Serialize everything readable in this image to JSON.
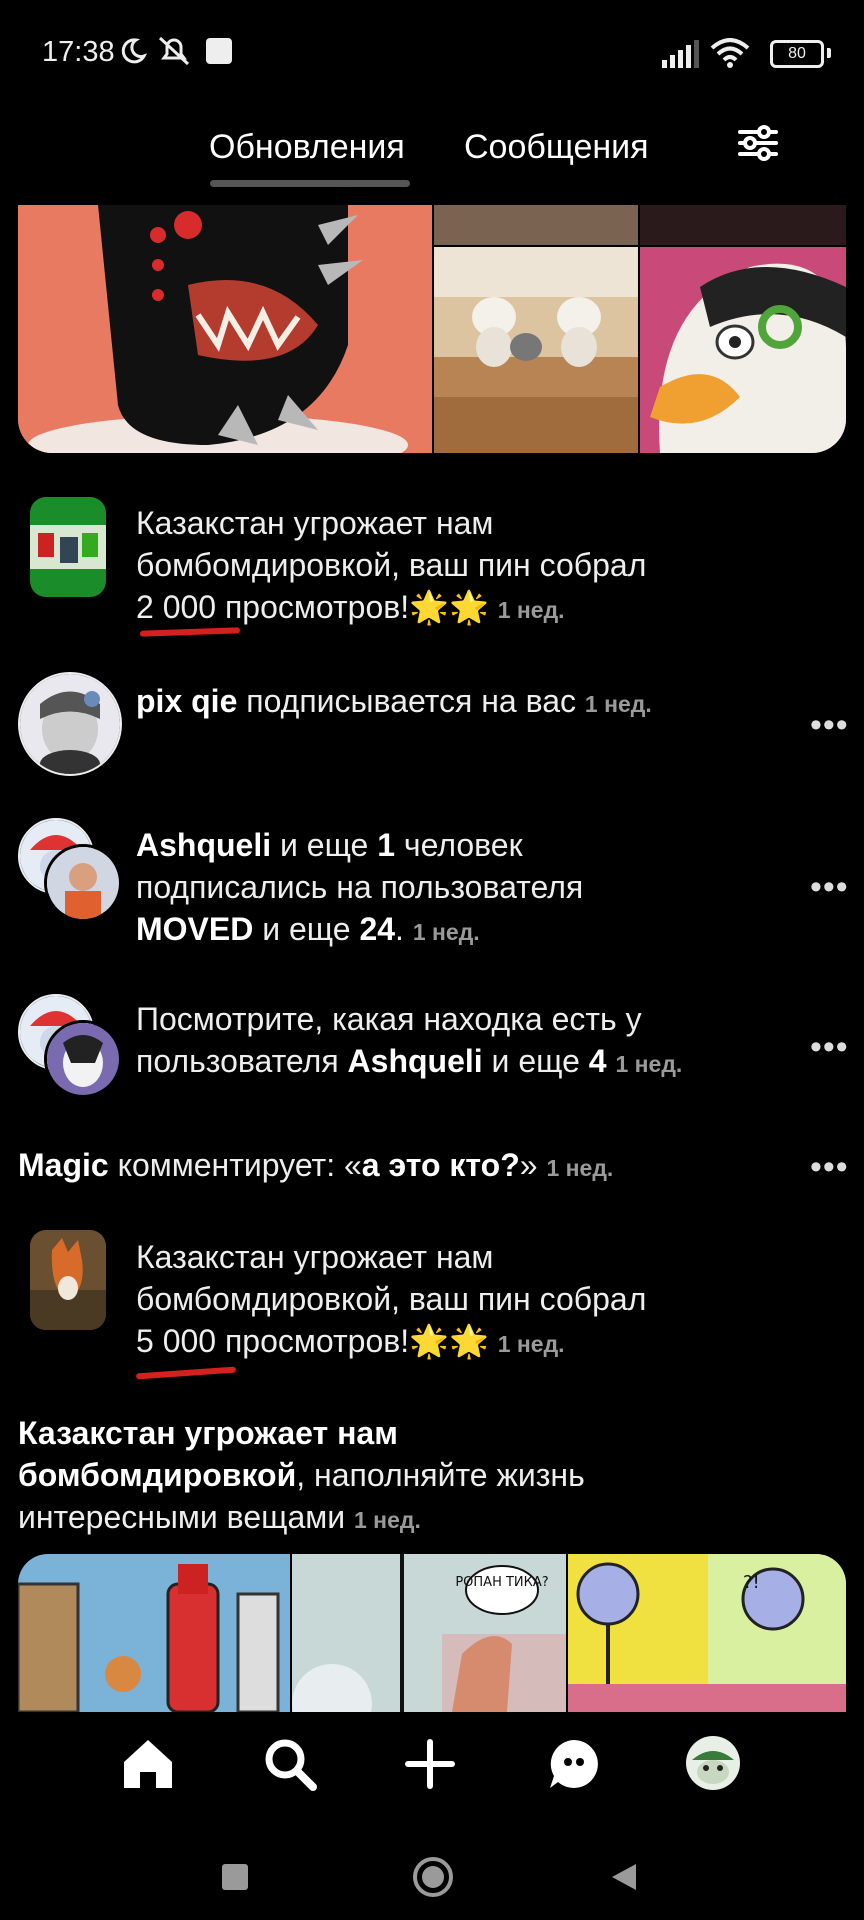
{
  "status_bar": {
    "time": "17:38",
    "battery": "80"
  },
  "tabs": {
    "updates": "Обновления",
    "messages": "Сообщения"
  },
  "notifications": [
    {
      "title_l1": "Казакстан угрожает нам",
      "title_l2": "бомбомдировкой, ваш пин собрал",
      "views": "2 000",
      "views_suffix": "просмотров!",
      "stars": "🌟🌟",
      "time": "1 нед."
    },
    {
      "user": "pix qie",
      "text": "подписывается на вас",
      "time": "1 нед."
    },
    {
      "user": "Ashqueli",
      "mid": "и еще",
      "count": "1",
      "mid2": "человек",
      "line2": "подписались на пользователя",
      "target": "MOVED",
      "mid3": "и еще",
      "count2": "24",
      "dot": ".",
      "time": "1 нед."
    },
    {
      "line1": "Посмотрите, какая находка есть у",
      "line2_pre": "пользователя",
      "user": "Ashqueli",
      "mid": "и еще",
      "count": "4",
      "time": "1 нед."
    },
    {
      "user": "Magic",
      "text": "комментирует: «",
      "quote": "а это кто?",
      "close": "»",
      "time": "1 нед."
    },
    {
      "title_l1": "Казакстан угрожает нам",
      "title_l2": "бомбомдировкой, ваш пин собрал",
      "views": "5 000",
      "views_suffix": "просмотров!",
      "stars": "🌟🌟",
      "time": "1 нед."
    },
    {
      "board_l1": "Казакстан угрожает нам",
      "board_l2": "бомбомдировкой",
      "rest_l2": ", наполняйте жизнь",
      "line3": "интересными вещами",
      "time": "1 нед."
    }
  ],
  "more_icon": "•••",
  "collage2_texts": {
    "bubble1": "РОПАН ТИКА?",
    "bubble2": "?!"
  },
  "colors": {
    "background": "#000000",
    "underline": "#d52020"
  },
  "icons": [
    "home-icon",
    "search-icon",
    "plus-icon",
    "messages-icon",
    "profile-avatar"
  ]
}
